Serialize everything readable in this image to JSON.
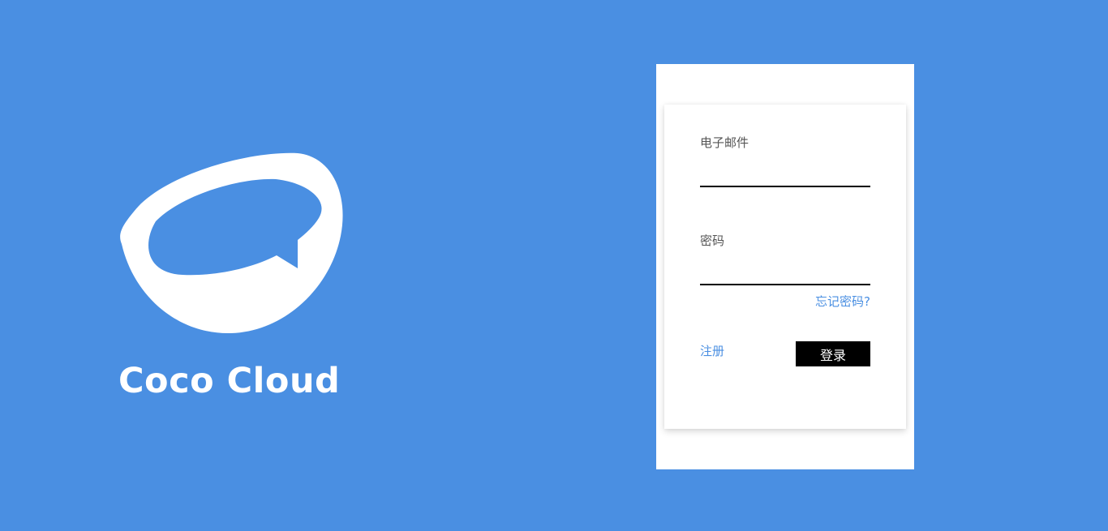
{
  "brand": {
    "name": "Coco Cloud",
    "logo_icon": "coconut-chat-icon",
    "background_color": "#4a8fe2"
  },
  "login": {
    "email_label": "电子邮件",
    "email_value": "",
    "password_label": "密码",
    "password_value": "",
    "forgot_password": "忘记密码?",
    "register": "注册",
    "login_button": "登录"
  },
  "colors": {
    "accent": "#4a8fe2",
    "button": "#000000",
    "panel": "#ffffff"
  }
}
